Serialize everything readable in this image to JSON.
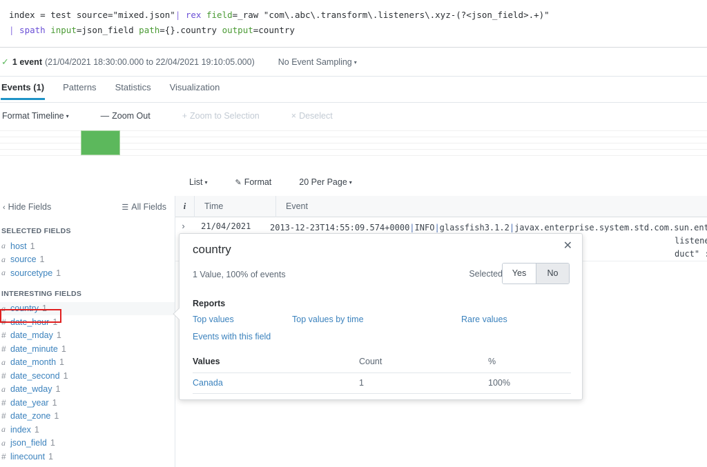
{
  "search": {
    "line1": [
      {
        "t": "index = test source=\"mixed.json\"",
        "c": "txt"
      },
      {
        "t": "|",
        "c": "pipe"
      },
      {
        "t": " rex ",
        "c": "cmd"
      },
      {
        "t": "field",
        "c": "arg"
      },
      {
        "t": "=_raw \"com\\.abc\\.transform\\.listeners\\.xyz-(?<json_field>.+)\"",
        "c": "txt"
      }
    ],
    "line2": [
      {
        "t": "|",
        "c": "pipe"
      },
      {
        "t": " spath ",
        "c": "cmd"
      },
      {
        "t": "input",
        "c": "arg"
      },
      {
        "t": "=json_field ",
        "c": "txt"
      },
      {
        "t": "path",
        "c": "arg"
      },
      {
        "t": "={}.country ",
        "c": "txt"
      },
      {
        "t": "output",
        "c": "arg"
      },
      {
        "t": "=country",
        "c": "txt"
      }
    ]
  },
  "results": {
    "check_icon": "check-icon",
    "event_count": "1 event",
    "time_range": "(21/04/2021 18:30:00.000 to 22/04/2021 19:10:05.000)",
    "sampling": "No Event Sampling",
    "caret": "▾"
  },
  "tabs": [
    {
      "label": "Events (1)",
      "active": true
    },
    {
      "label": "Patterns",
      "active": false
    },
    {
      "label": "Statistics",
      "active": false
    },
    {
      "label": "Visualization",
      "active": false
    }
  ],
  "timeline_tools": [
    {
      "sym": "",
      "label": "Format Timeline",
      "caret": "▾",
      "dim": false
    },
    {
      "sym": "—",
      "label": "Zoom Out",
      "caret": "",
      "dim": false
    },
    {
      "sym": "+",
      "label": "Zoom to Selection",
      "caret": "",
      "dim": true
    },
    {
      "sym": "×",
      "label": "Deselect",
      "caret": "",
      "dim": true
    }
  ],
  "chart_data": {
    "type": "bar",
    "title": "",
    "categories": [
      "21/04/2021 18:30"
    ],
    "values": [
      1
    ],
    "xlabel": "",
    "ylabel": "",
    "ylim": [
      0,
      1
    ],
    "bar_color": "#5cb85c",
    "grid": true,
    "gridline_count": 5
  },
  "event_tools": [
    {
      "label": "List",
      "caret": "▾",
      "icon": ""
    },
    {
      "label": "Format",
      "caret": "",
      "icon": "✎"
    },
    {
      "label": "20 Per Page",
      "caret": "▾",
      "icon": ""
    }
  ],
  "sidebar": {
    "hide_fields": "Hide Fields",
    "hide_icon": "chevron-left-icon",
    "hide_caret": "‹",
    "all_fields": "All Fields",
    "all_fields_icon": "list-icon",
    "all_fields_glyph": "☰",
    "selected_title": "SELECTED FIELDS",
    "selected": [
      {
        "type": "a",
        "name": "host",
        "count": "1"
      },
      {
        "type": "a",
        "name": "source",
        "count": "1"
      },
      {
        "type": "a",
        "name": "sourcetype",
        "count": "1"
      }
    ],
    "interesting_title": "INTERESTING FIELDS",
    "interesting": [
      {
        "type": "a",
        "name": "country",
        "count": "1",
        "highlight": true
      },
      {
        "type": "#",
        "name": "date_hour",
        "count": "1"
      },
      {
        "type": "#",
        "name": "date_mday",
        "count": "1"
      },
      {
        "type": "#",
        "name": "date_minute",
        "count": "1"
      },
      {
        "type": "a",
        "name": "date_month",
        "count": "1"
      },
      {
        "type": "#",
        "name": "date_second",
        "count": "1"
      },
      {
        "type": "a",
        "name": "date_wday",
        "count": "1"
      },
      {
        "type": "#",
        "name": "date_year",
        "count": "1"
      },
      {
        "type": "#",
        "name": "date_zone",
        "count": "1"
      },
      {
        "type": "a",
        "name": "index",
        "count": "1"
      },
      {
        "type": "a",
        "name": "json_field",
        "count": "1"
      },
      {
        "type": "#",
        "name": "linecount",
        "count": "1"
      }
    ]
  },
  "events_table": {
    "col_i": "i",
    "col_time": "Time",
    "col_event": "Event",
    "rows": [
      {
        "expand": "›",
        "time": "21/04/2021",
        "event_parts": [
          {
            "t": "2013-12-23T14:55:09.574+0000",
            "c": "plain"
          },
          {
            "t": "|",
            "c": "blue"
          },
          {
            "t": "INFO",
            "c": "plain"
          },
          {
            "t": "|",
            "c": "blue"
          },
          {
            "t": "glassfish3.1.2",
            "c": "plain"
          },
          {
            "t": "|",
            "c": "blue"
          },
          {
            "t": "javax.enterprise.system.std.com.sun.enterp",
            "c": "plain"
          }
        ],
        "event_tail_1": "listeners.xyz- [{   \"timest",
        "event_tail_2": "duct\" : \"iPad\",   \"msg\" : \""
      }
    ]
  },
  "popover": {
    "title": "country",
    "close_icon": "close-icon",
    "close_glyph": "✕",
    "summary": "1 Value, 100% of events",
    "selected_label": "Selected",
    "toggle": [
      {
        "label": "Yes",
        "on": false
      },
      {
        "label": "No",
        "on": true
      }
    ],
    "reports_title": "Reports",
    "reports": [
      "Top values",
      "Top values by time",
      "Rare values",
      "Events with this field"
    ],
    "values_headers": [
      "Values",
      "Count",
      "%"
    ],
    "values_rows": [
      {
        "value": "Canada",
        "count": "1",
        "percent": "100%"
      }
    ]
  },
  "colors": {
    "accent": "#1e93c6",
    "link": "#3b82bd",
    "bar_green": "#5cb85c",
    "highlight_red": "#e02020"
  }
}
